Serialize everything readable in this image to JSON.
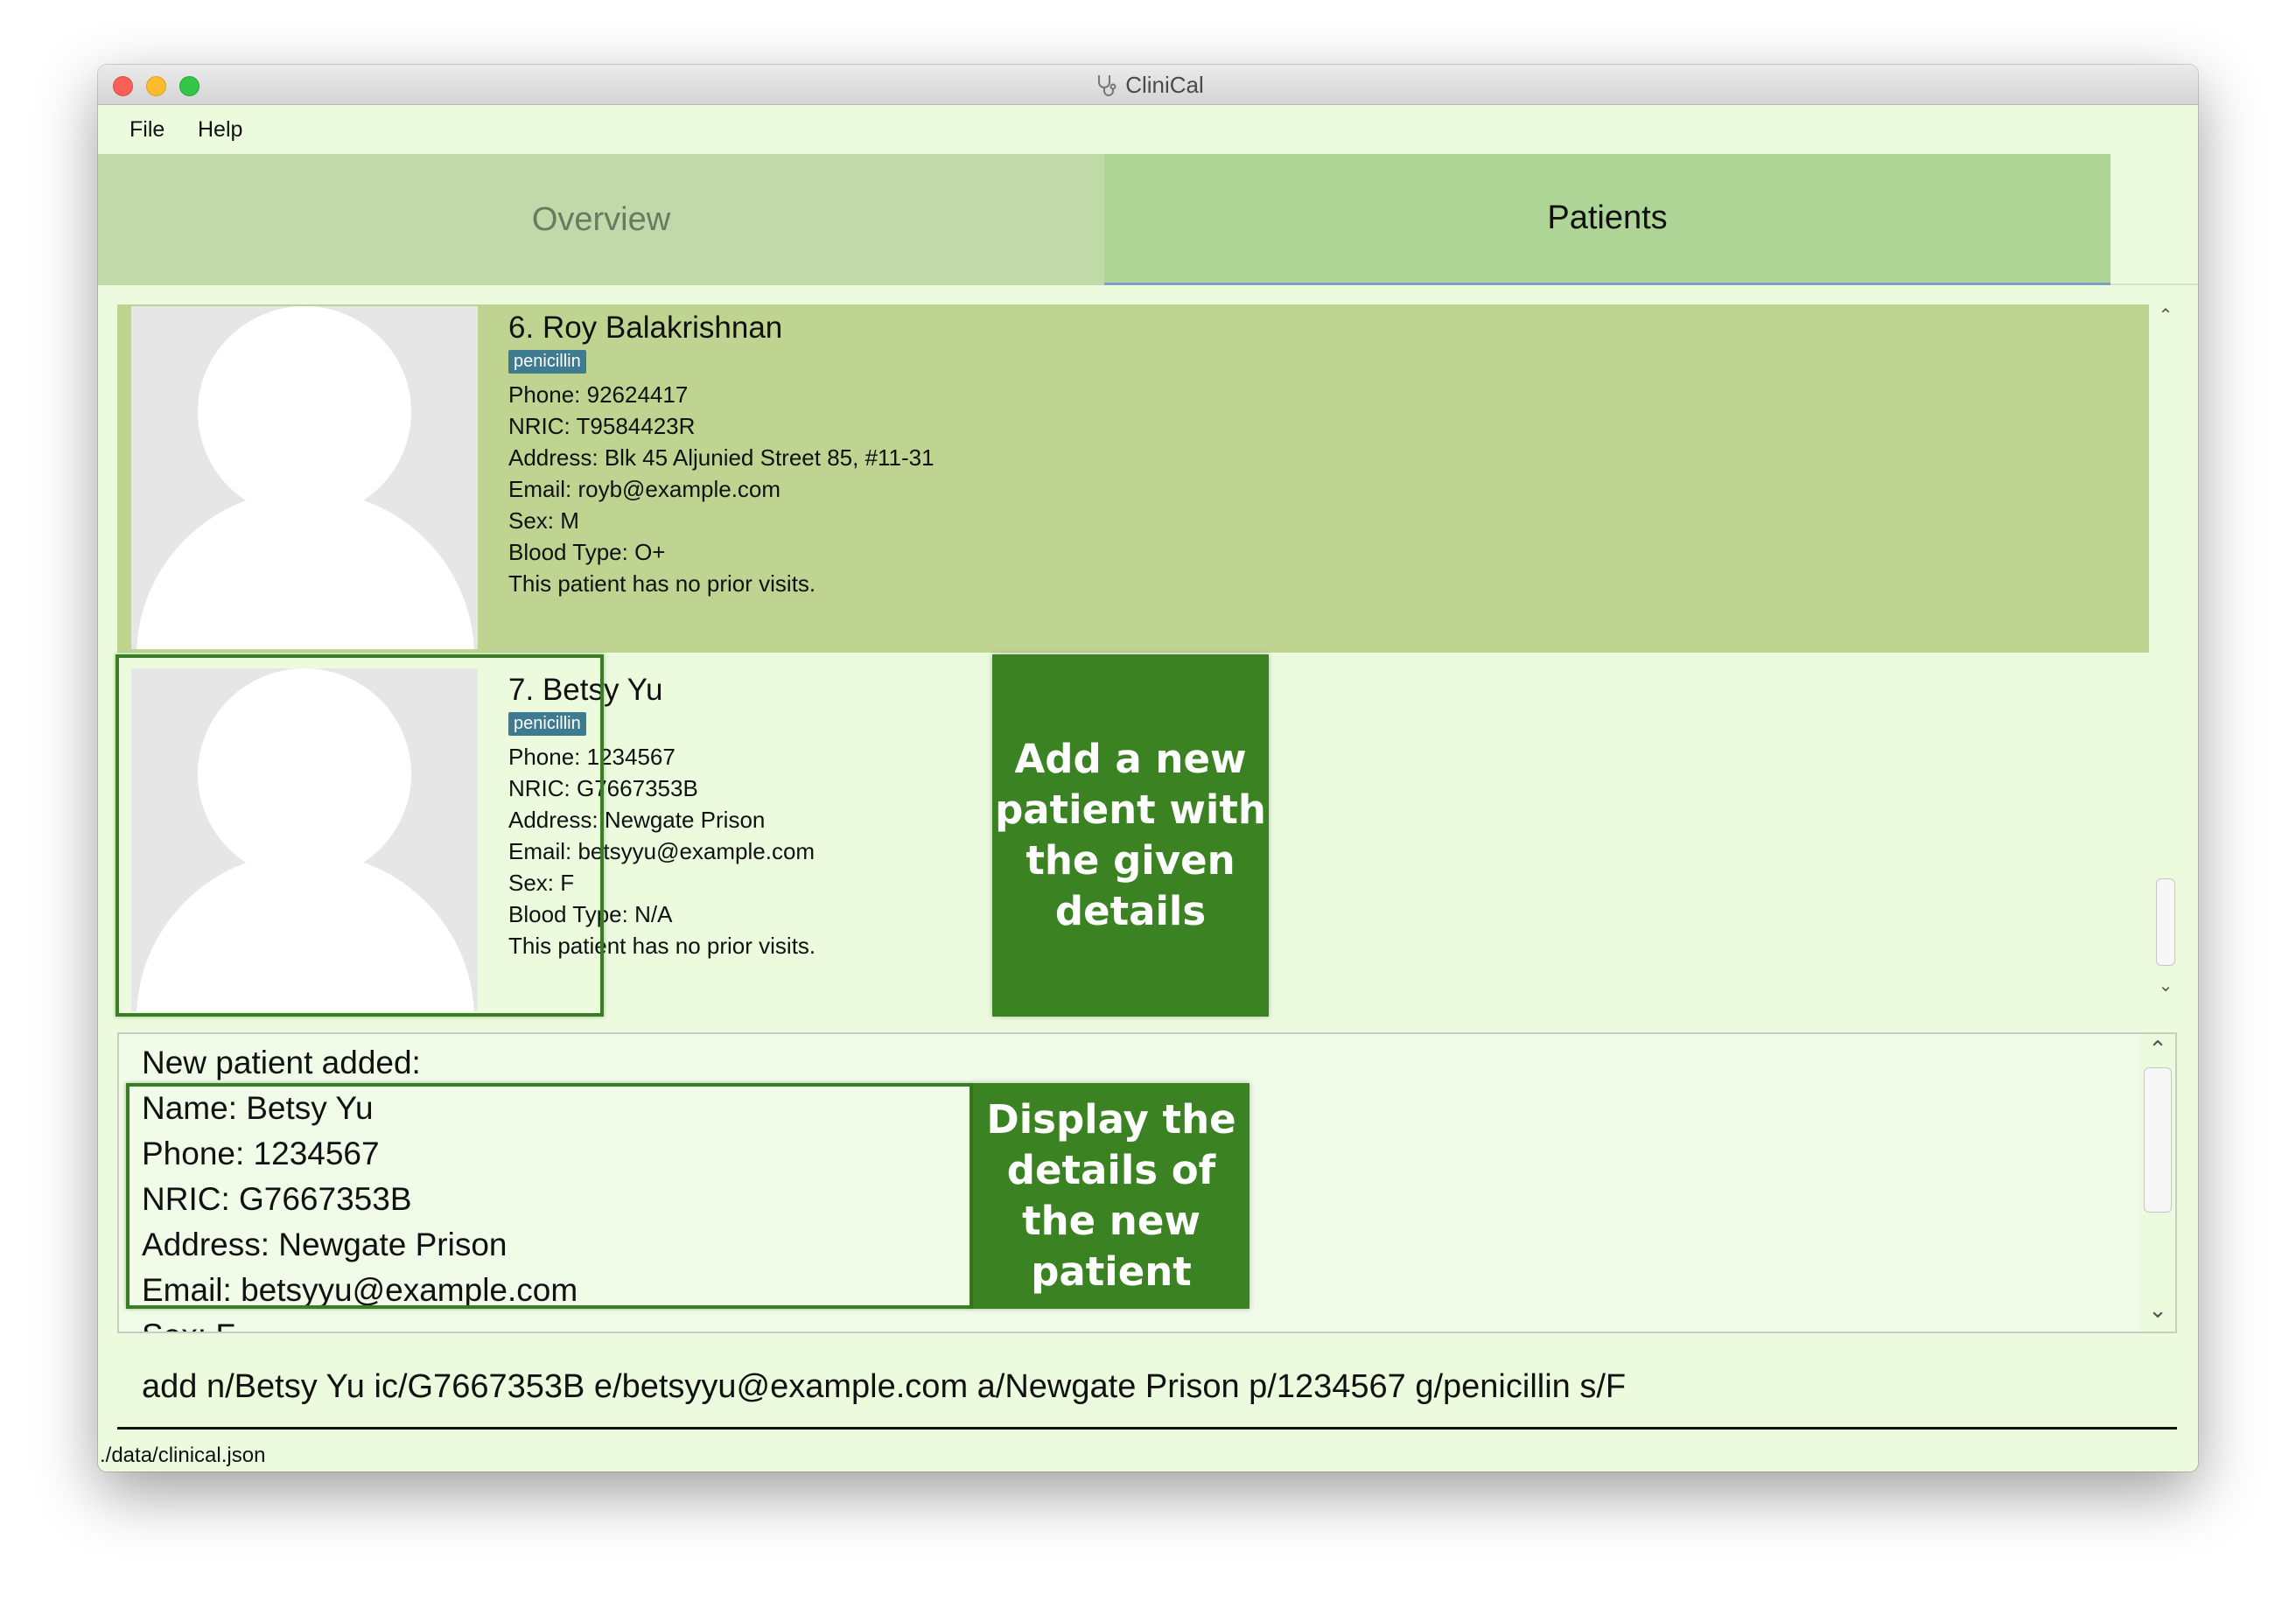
{
  "window": {
    "title": "CliniCal",
    "icon": "stethoscope-icon"
  },
  "menu": {
    "items": [
      "File",
      "Help"
    ]
  },
  "tabs": {
    "overview": "Overview",
    "patients": "Patients"
  },
  "patients": [
    {
      "index": "6.",
      "name": "Roy Balakrishnan",
      "tag": "penicillin",
      "phone": "Phone: 92624417",
      "nric": "NRIC: T9584423R",
      "address": "Address: Blk 45 Aljunied Street 85, #11-31",
      "email": "Email: royb@example.com",
      "sex": "Sex: M",
      "blood": "Blood Type: O+",
      "visits": "This patient has no prior visits."
    },
    {
      "index": "7.",
      "name": "Betsy Yu",
      "tag": "penicillin",
      "phone": "Phone: 1234567",
      "nric": "NRIC: G7667353B",
      "address": "Address: Newgate Prison",
      "email": "Email: betsyyu@example.com",
      "sex": "Sex: F",
      "blood": "Blood Type: N/A",
      "visits": "This patient has no prior visits."
    }
  ],
  "callouts": {
    "add": "Add a new patient with the given details",
    "display": "Display the details of the new patient"
  },
  "result": {
    "lines": [
      "New patient added:",
      "Name: Betsy Yu",
      "Phone: 1234567",
      "NRIC: G7667353B",
      "Address: Newgate Prison",
      "Email: betsyyu@example.com",
      "Sex: F"
    ]
  },
  "command": {
    "value": "add n/Betsy Yu ic/G7667353B e/betsyyu@example.com a/Newgate Prison p/1234567 g/penicillin s/F"
  },
  "status": {
    "path": "./data/clinical.json"
  },
  "colors": {
    "selected_card": "#bfd491",
    "tag_bg": "#3e7b91",
    "callout_bg": "#3b8222",
    "background": "#ecfbde"
  }
}
